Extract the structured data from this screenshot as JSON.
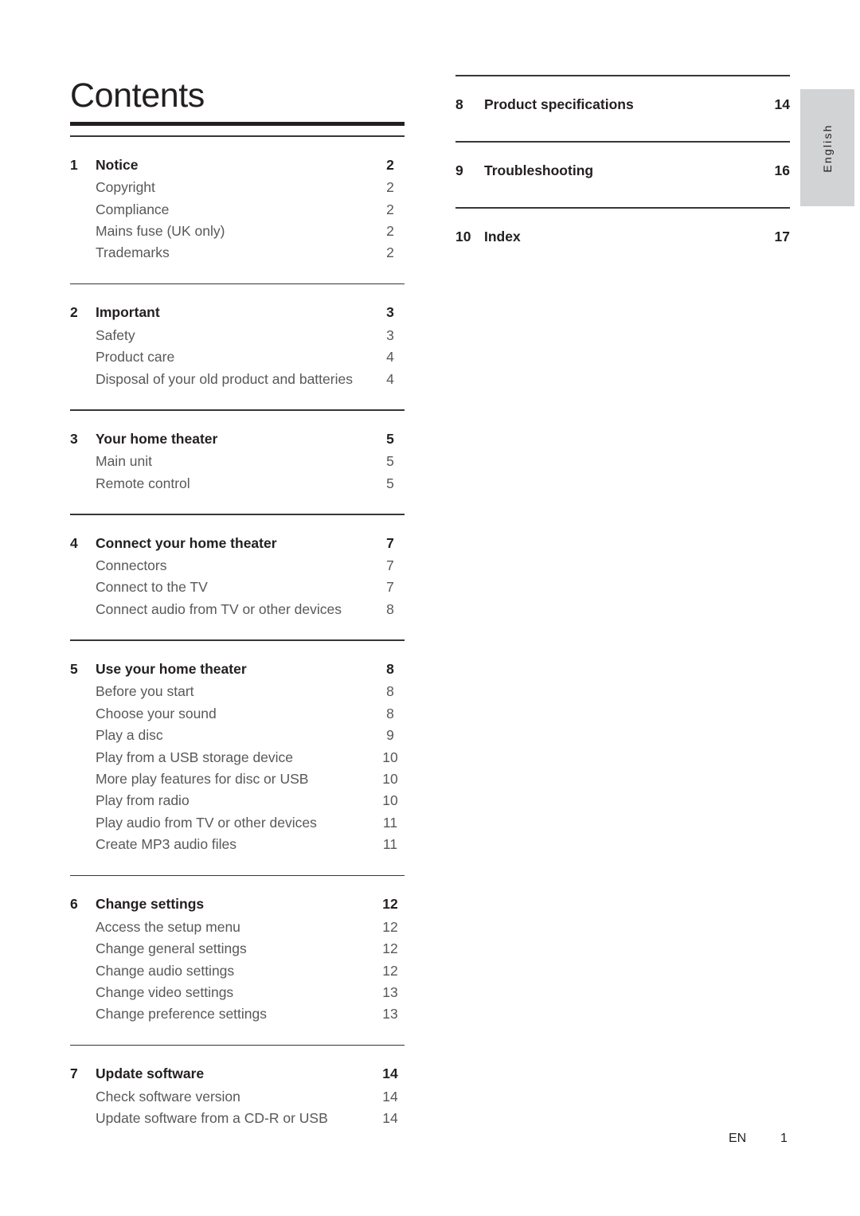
{
  "document": {
    "title": "Contents",
    "language_tab": "English"
  },
  "footer": {
    "locale_code": "EN",
    "page_number": "1"
  },
  "toc": {
    "left_column": [
      {
        "number": "1",
        "title": "Notice",
        "page": "2",
        "subitems": [
          {
            "title": "Copyright",
            "page": "2"
          },
          {
            "title": "Compliance",
            "page": "2"
          },
          {
            "title": "Mains fuse (UK only)",
            "page": "2"
          },
          {
            "title": "Trademarks",
            "page": "2"
          }
        ]
      },
      {
        "number": "2",
        "title": "Important",
        "page": "3",
        "subitems": [
          {
            "title": "Safety",
            "page": "3"
          },
          {
            "title": "Product care",
            "page": "4"
          },
          {
            "title": "Disposal of your old product and batteries",
            "page": "4"
          }
        ]
      },
      {
        "number": "3",
        "title": "Your home theater",
        "page": "5",
        "subitems": [
          {
            "title": "Main unit",
            "page": "5"
          },
          {
            "title": "Remote control",
            "page": "5"
          }
        ]
      },
      {
        "number": "4",
        "title": "Connect your home theater",
        "page": "7",
        "subitems": [
          {
            "title": "Connectors",
            "page": "7"
          },
          {
            "title": "Connect to the TV",
            "page": "7"
          },
          {
            "title": "Connect audio from TV or other devices",
            "page": "8"
          }
        ]
      },
      {
        "number": "5",
        "title": "Use your home theater",
        "page": "8",
        "subitems": [
          {
            "title": "Before you start",
            "page": "8"
          },
          {
            "title": "Choose your sound",
            "page": "8"
          },
          {
            "title": "Play a disc",
            "page": "9"
          },
          {
            "title": "Play from a USB storage device",
            "page": "10"
          },
          {
            "title": "More play features for disc or USB",
            "page": "10"
          },
          {
            "title": "Play from radio",
            "page": "10"
          },
          {
            "title": "Play audio from TV or other devices",
            "page": "11"
          },
          {
            "title": "Create MP3 audio files",
            "page": "11"
          }
        ]
      },
      {
        "number": "6",
        "title": "Change settings",
        "page": "12",
        "subitems": [
          {
            "title": "Access the setup menu",
            "page": "12"
          },
          {
            "title": "Change general settings",
            "page": "12"
          },
          {
            "title": "Change audio settings",
            "page": "12"
          },
          {
            "title": "Change video settings",
            "page": "13"
          },
          {
            "title": "Change preference settings",
            "page": "13"
          }
        ]
      },
      {
        "number": "7",
        "title": "Update software",
        "page": "14",
        "subitems": [
          {
            "title": "Check software version",
            "page": "14"
          },
          {
            "title": "Update software from a CD-R or USB",
            "page": "14"
          }
        ]
      }
    ],
    "right_column": [
      {
        "number": "8",
        "title": "Product specifications",
        "page": "14",
        "subitems": []
      },
      {
        "number": "9",
        "title": "Troubleshooting",
        "page": "16",
        "subitems": []
      },
      {
        "number": "10",
        "title": "Index",
        "page": "17",
        "subitems": []
      }
    ]
  }
}
